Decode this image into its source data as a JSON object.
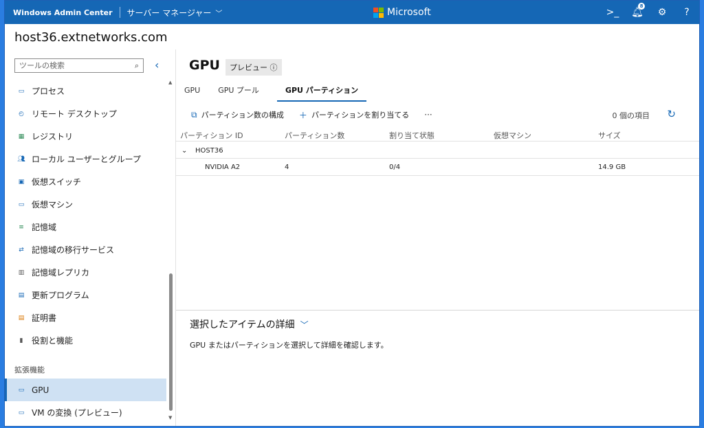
{
  "topbar": {
    "brand": "Windows Admin Center",
    "server_manager": "サーバー マネージャー",
    "microsoft": "Microsoft",
    "notification_count": "8",
    "colors": {
      "bar": "#1567b5"
    }
  },
  "host": {
    "name": "host36.extnetworks.com"
  },
  "sidebar": {
    "search_placeholder": "ツールの検索",
    "items": [
      {
        "label": "プロセス",
        "icon": "process-icon",
        "color": "#1567b5"
      },
      {
        "label": "リモート デスクトップ",
        "icon": "remote-desktop-icon",
        "color": "#1567b5"
      },
      {
        "label": "レジストリ",
        "icon": "registry-icon",
        "color": "#2e8b57"
      },
      {
        "label": "ローカル ユーザーとグループ",
        "icon": "users-icon",
        "color": "#1567b5"
      },
      {
        "label": "仮想スイッチ",
        "icon": "virtual-switch-icon",
        "color": "#1567b5"
      },
      {
        "label": "仮想マシン",
        "icon": "virtual-machine-icon",
        "color": "#1567b5"
      },
      {
        "label": "記憶域",
        "icon": "storage-icon",
        "color": "#2e8b57"
      },
      {
        "label": "記憶域の移行サービス",
        "icon": "storage-migration-icon",
        "color": "#1567b5"
      },
      {
        "label": "記憶域レプリカ",
        "icon": "storage-replica-icon",
        "color": "#555555"
      },
      {
        "label": "更新プログラム",
        "icon": "updates-icon",
        "color": "#1567b5"
      },
      {
        "label": "証明書",
        "icon": "certificate-icon",
        "color": "#d97706"
      },
      {
        "label": "役割と機能",
        "icon": "roles-icon",
        "color": "#555555"
      }
    ],
    "section_title": "拡張機能",
    "extensions": [
      {
        "label": "GPU",
        "icon": "gpu-icon",
        "active": true
      },
      {
        "label": "VM の変換 (プレビュー)",
        "icon": "vm-conversion-icon",
        "active": false
      }
    ]
  },
  "main": {
    "title": "GPU",
    "preview_badge": "プレビュー ⓘ",
    "tabs": [
      {
        "label": "GPU",
        "active": false
      },
      {
        "label": "GPU プール",
        "active": false
      },
      {
        "label": "GPU パーティション",
        "active": true
      }
    ],
    "toolbar": {
      "configure_label": "パーティション数の構成",
      "assign_label": "パーティションを割り当てる",
      "more_label": "···",
      "item_count": "0 個の項目"
    },
    "table": {
      "columns": [
        "パーティション ID",
        "パーティション数",
        "割り当て状態",
        "仮想マシン",
        "サイズ"
      ],
      "group_label": "HOST36",
      "rows": [
        {
          "name": "NVIDIA A2",
          "count": "4",
          "assigned": "0/4",
          "vm": "",
          "size": "14.9 GB"
        }
      ]
    },
    "details": {
      "title": "選択したアイテムの詳細",
      "text": "GPU またはパーティションを選択して詳細を確認します。"
    }
  }
}
